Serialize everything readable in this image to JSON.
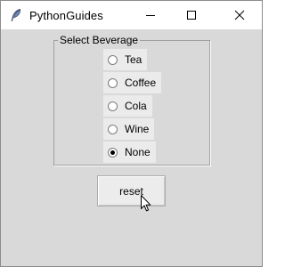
{
  "window": {
    "title": "PythonGuides",
    "icon": "feather-icon",
    "controls": [
      "minimize-icon",
      "maximize-icon",
      "close-icon"
    ]
  },
  "group": {
    "label": "Select Beverage",
    "options": [
      {
        "label": "Tea",
        "checked": false
      },
      {
        "label": "Coffee",
        "checked": false
      },
      {
        "label": "Cola",
        "checked": false
      },
      {
        "label": "Wine",
        "checked": false
      },
      {
        "label": "None",
        "checked": true
      }
    ]
  },
  "reset_button": {
    "label": "reset"
  },
  "cursor": "arrow-cursor-icon"
}
